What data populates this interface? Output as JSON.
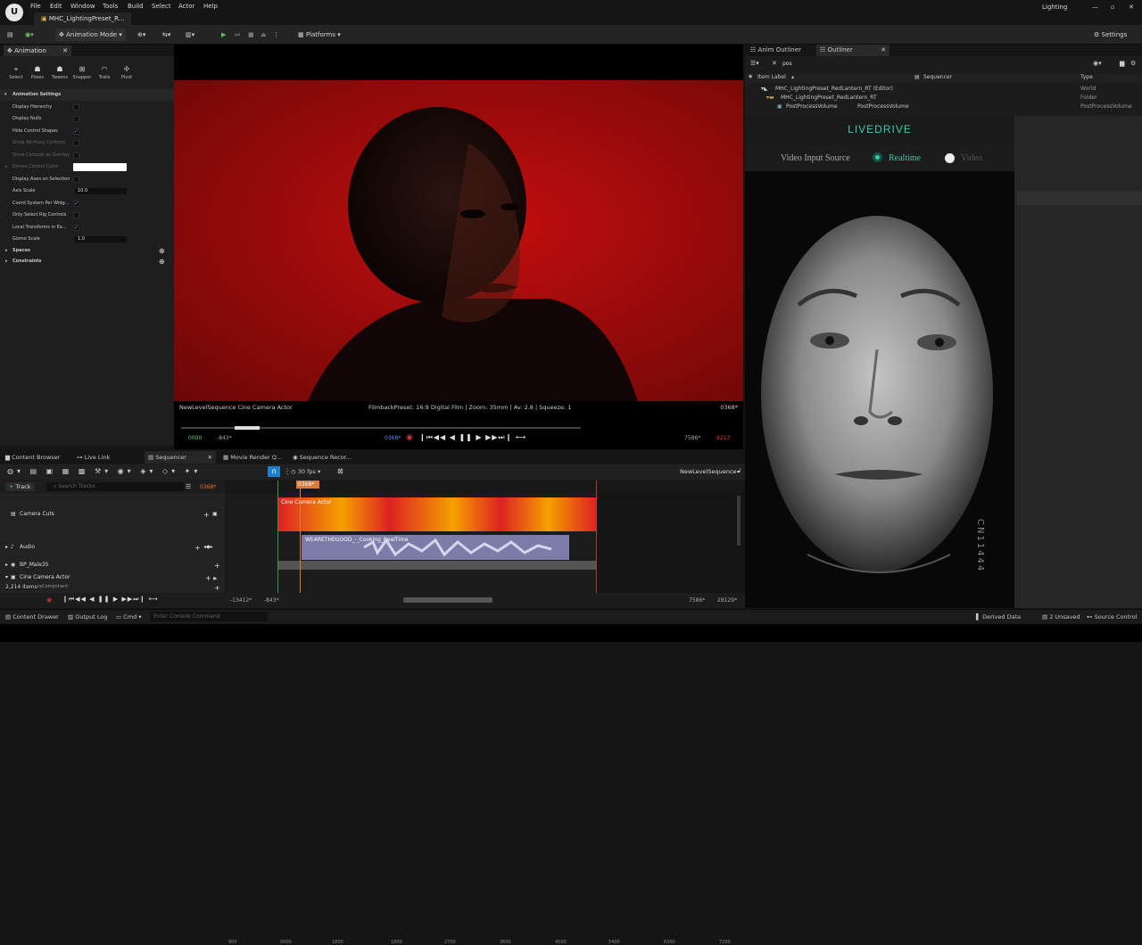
{
  "menubar": {
    "items": [
      "File",
      "Edit",
      "Window",
      "Tools",
      "Build",
      "Select",
      "Actor",
      "Help"
    ],
    "project_tab": "MHC_LightingPreset_R...",
    "layout_label": "Lighting"
  },
  "toolbar": {
    "mode_label": "Animation Mode",
    "platforms_label": "Platforms",
    "settings_label": "Settings"
  },
  "left_panel": {
    "tab": "Animation",
    "modes": [
      "Select",
      "Poses",
      "Tweens",
      "Snapper",
      "Trails",
      "Pivot"
    ],
    "section": "Animation Settings",
    "props": [
      {
        "label": "Display Hierarchy",
        "checked": false,
        "dim": false
      },
      {
        "label": "Display Nulls",
        "checked": false,
        "dim": false
      },
      {
        "label": "Hide Control Shapes",
        "checked": true,
        "dim": false
      },
      {
        "label": "Show All Proxy Controls",
        "checked": false,
        "dim": true
      },
      {
        "label": "Show Controls as Overlay",
        "checked": false,
        "dim": true
      },
      {
        "label": "Driven Control Color",
        "checked": false,
        "dim": true
      },
      {
        "label": "Display Axes on Selection",
        "checked": false,
        "dim": false
      },
      {
        "label": "Axis Scale",
        "value": "10.0",
        "dim": false
      },
      {
        "label": "Coord System Per Widg...",
        "checked": true,
        "dim": false
      },
      {
        "label": "Only Select Rig Controls",
        "checked": false,
        "dim": false
      },
      {
        "label": "Local Transforms in Ea...",
        "checked": true,
        "dim": false
      },
      {
        "label": "Gizmo Scale",
        "value": "1.0",
        "dim": false
      }
    ],
    "sub_sections": [
      "Spaces",
      "Constraints"
    ]
  },
  "viewport": {
    "camera_label": "NewLevelSequence Cine Camera Actor",
    "filmback_label": "FilmbackPreset: 16:9 Digital Film | Zoom: 35mm | Av: 2.8 | Squeeze: 1",
    "frame_label": "0368*",
    "start_frame": "0000",
    "left_frame": "-843*",
    "current_frame": "0368*",
    "right_frame": "7586*",
    "end_frame": "8213"
  },
  "outliner": {
    "tabs": [
      "Anim Outliner",
      "Outliner"
    ],
    "search_value": "pos",
    "col_label": "Item Label",
    "col_sequencer": "Sequencer",
    "col_type": "Type",
    "rows": [
      {
        "label": "MHC_LightingPreset_RedLantern_RT (Editor)",
        "type": "World",
        "indent": 0
      },
      {
        "label": "MHC_LightingPreset_RedLantern_RT",
        "type": "Folder",
        "indent": 1
      },
      {
        "label": "PostProcessVolume",
        "type": "PostProcessVolume",
        "indent": 2,
        "seq": "PostProcessVolume"
      }
    ]
  },
  "livedrive": {
    "title": "LIVEDRIVE",
    "source_label": "Video Input Source",
    "option_realtime": "Realtime",
    "option_video": "Video",
    "side_text": "CN11444"
  },
  "sequencer": {
    "tabs": [
      "Content Browser",
      "Live Link",
      "Sequencer",
      "Movie Render Q...",
      "Sequence Recor..."
    ],
    "fps": "30 fps",
    "sequence_name": "NewLevelSequence",
    "add_track": "Track",
    "search_placeholder": "Search Tracks",
    "frame": "0368*",
    "tracks": [
      "Camera Cuts",
      "Audio",
      "BP_Male35",
      "Cine Camera Actor"
    ],
    "item_count": "2,214 items",
    "sub_label": "raComponent",
    "camera_clip": "Cine Camera Actor",
    "audio_clip": "WEARETHEGOOD_-_Cooking_RealTime",
    "ruler": [
      "900",
      "0000",
      "1800",
      "1800",
      "2700",
      "3600",
      "4500",
      "5400",
      "6300",
      "7200"
    ],
    "bottom_left": "-13412*",
    "bottom_left2": "-843*",
    "bottom_right": "7586*",
    "bottom_right2": "28129*"
  },
  "statusbar": {
    "content_drawer": "Content Drawer",
    "output_log": "Output Log",
    "cmd": "Cmd",
    "console_placeholder": "Enter Console Command",
    "derived": "Derived Data",
    "unsaved": "2 Unsaved",
    "source": "Source Control"
  }
}
